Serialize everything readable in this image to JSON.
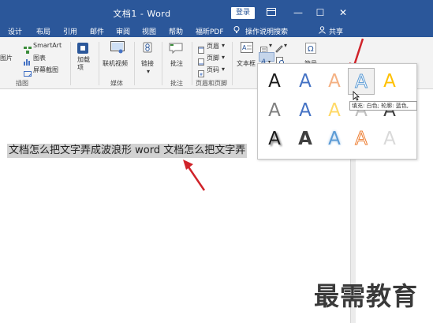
{
  "window": {
    "title": "文档1 - Word",
    "login_label": "登录",
    "controls": {
      "ribbon_display_icon": "ribbon-display-icon",
      "minimize": "—",
      "restore": "☐",
      "close": "✕"
    }
  },
  "tabs": {
    "items": [
      "设计",
      "布局",
      "引用",
      "邮件",
      "审阅",
      "视图",
      "帮助",
      "福昕PDF"
    ],
    "tell_me": "操作说明搜索",
    "share": "共享"
  },
  "ribbon": {
    "illustrations": {
      "smartart": "SmartArt",
      "picture_partial": "图片",
      "chart": "图表",
      "screenshot": "屏幕截图",
      "label": "插图"
    },
    "addins": {
      "button": "加载\n项",
      "label": ""
    },
    "media": {
      "online_video": "联机视频",
      "label": "媒体"
    },
    "links": {
      "button": "链接",
      "label": ""
    },
    "comments": {
      "button": "批注",
      "label": "批注"
    },
    "header_footer": {
      "header": "页眉",
      "footer": "页脚",
      "page_number": "页码",
      "label": "页眉和页脚"
    },
    "text": {
      "textbox": "文本框"
    },
    "symbols": {
      "button": "符号"
    }
  },
  "document": {
    "selected_text": "文档怎么把文字弄成波浪形 word 文档怎么把文字弄"
  },
  "wordart_gallery": {
    "glyph": "A",
    "rows": [
      [
        {
          "style": "solid-black",
          "color": "#1a1a1a"
        },
        {
          "style": "solid-blue",
          "color": "#4472c4"
        },
        {
          "style": "gradient-orange",
          "color": "#f4b183"
        },
        {
          "style": "outline-white-blue",
          "color": "#ffffff",
          "stroke": "#5b9bd5"
        },
        {
          "style": "solid-gold",
          "color": "#ffc000"
        }
      ],
      [
        {
          "style": "light-gray",
          "color": "#7f7f7f"
        },
        {
          "style": "blue-reflect",
          "color": "#4472c4"
        },
        {
          "style": "gold-soft",
          "color": "#ffd966"
        },
        {
          "style": "gray-reflect",
          "color": "#bfbfbf"
        },
        {
          "style": "dark-partial",
          "color": "#404040"
        }
      ],
      [
        {
          "style": "shadow-black",
          "color": "#1a1a1a"
        },
        {
          "style": "bold-dark-gray",
          "color": "#3f3f3f"
        },
        {
          "style": "light-blue-glow",
          "color": "#5b9bd5"
        },
        {
          "style": "orange-outline",
          "color": "#ffffff",
          "stroke": "#ed7d31"
        },
        {
          "style": "very-light-gray",
          "color": "#d9d9d9"
        }
      ]
    ],
    "tooltip": "填充: 白色; 轮廓: 蓝色,"
  },
  "watermark": "最需教育",
  "colors": {
    "word_blue": "#2b579a",
    "annotation_red": "#d0232a",
    "ribbon_bg": "#f3f3f3"
  }
}
